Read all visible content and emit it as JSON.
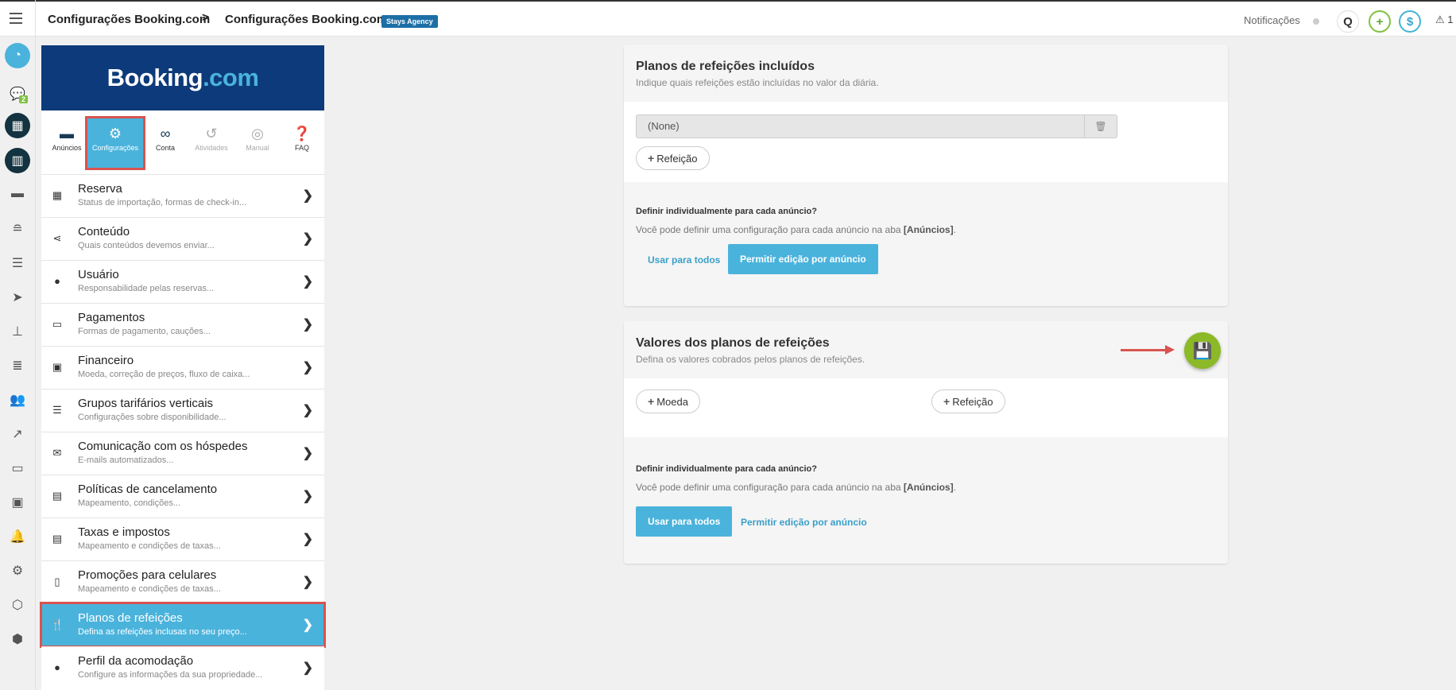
{
  "header": {
    "breadcrumb_1": "Configurações Booking.com",
    "breadcrumb_sep": ">",
    "breadcrumb_2": "Configurações Booking.com",
    "badge": "Stays Agency",
    "notifications_label": "Notificações",
    "search_icon": "Q",
    "plus_icon": "+",
    "money_icon": "$",
    "warning_text": "⚠ 1"
  },
  "rail": {
    "messages_badge": "2",
    "icons": [
      "dashboard-icon",
      "messages-icon",
      "calendar-icon",
      "stats-icon",
      "bed-icon",
      "database-icon",
      "list-icon",
      "send-icon",
      "sitemap-icon",
      "server-icon",
      "users-icon",
      "chart-icon",
      "monitor-icon",
      "money-icon",
      "bell-icon",
      "gear-icon",
      "box-icon",
      "boxes-icon"
    ]
  },
  "logo": {
    "brand": "Booking",
    "dot_com": ".com"
  },
  "tabs": [
    {
      "label": "Anúncios",
      "icon": "bed-icon"
    },
    {
      "label": "Configurações",
      "icon": "gears-icon"
    },
    {
      "label": "Conta",
      "icon": "link-icon"
    },
    {
      "label": "Atividades",
      "icon": "history-icon"
    },
    {
      "label": "Manual",
      "icon": "lifebuoy-icon"
    },
    {
      "label": "FAQ",
      "icon": "question-icon"
    }
  ],
  "menu": [
    {
      "title": "Reserva",
      "sub": "Status de importação, formas de check-in..."
    },
    {
      "title": "Conteúdo",
      "sub": "Quais conteúdos devemos enviar..."
    },
    {
      "title": "Usuário",
      "sub": "Responsabilidade pelas reservas..."
    },
    {
      "title": "Pagamentos",
      "sub": "Formas de pagamento, cauções..."
    },
    {
      "title": "Financeiro",
      "sub": "Moeda, correção de preços, fluxo de caixa..."
    },
    {
      "title": "Grupos tarifários verticais",
      "sub": "Configurações sobre disponibilidade..."
    },
    {
      "title": "Comunicação com os hóspedes",
      "sub": "E-mails automatizados..."
    },
    {
      "title": "Políticas de cancelamento",
      "sub": "Mapeamento, condições..."
    },
    {
      "title": "Taxas e impostos",
      "sub": "Mapeamento e condições de taxas..."
    },
    {
      "title": "Promoções para celulares",
      "sub": "Mapeamento e condições de taxas..."
    },
    {
      "title": "Planos de refeições",
      "sub": "Defina as refeições inclusas no seu preço..."
    },
    {
      "title": "Perfil da acomodação",
      "sub": "Configure as informações da sua propriedade..."
    }
  ],
  "card1": {
    "title": "Planos de refeições incluídos",
    "sub": "Indique quais refeições estão incluídas no valor da diária.",
    "field_value": "(None)",
    "add_button": "Refeição",
    "foot_title": "Definir individualmente para cada anúncio?",
    "foot_text": "Você pode definir uma configuração para cada anúncio na aba",
    "foot_tab": "[Anúncios]",
    "use_all": "Usar para todos",
    "allow_edit": "Permitir edição por anúncio"
  },
  "card2": {
    "title": "Valores dos planos de refeições",
    "sub": "Defina os valores cobrados pelos planos de refeições.",
    "currency_button": "Moeda",
    "meal_button": "Refeição",
    "foot_title": "Definir individualmente para cada anúncio?",
    "foot_text": "Você pode definir uma configuração para cada anúncio na aba",
    "foot_tab": "[Anúncios]",
    "use_all": "Usar para todos",
    "allow_edit": "Permitir edição por anúncio"
  },
  "colors": {
    "accent_blue": "#4ab3dc",
    "booking_navy": "#0d3a7a",
    "save_green": "#8cb928",
    "highlight_red": "#d9534f"
  }
}
